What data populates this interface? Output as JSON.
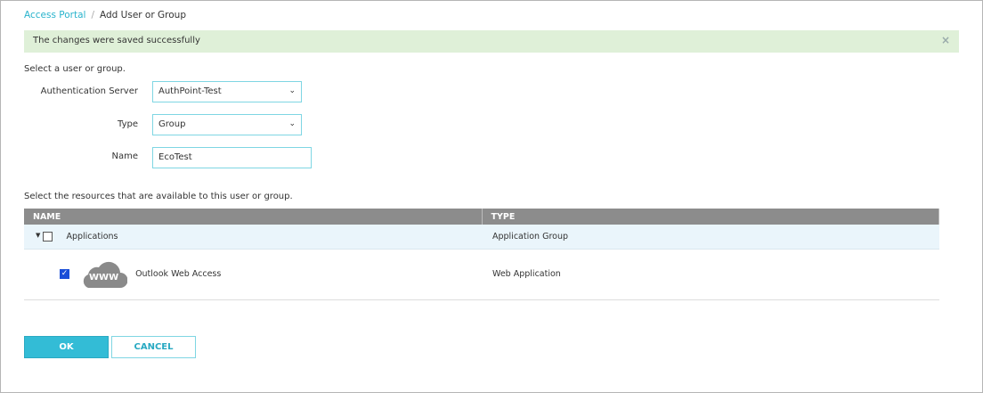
{
  "breadcrumb": {
    "parent": "Access Portal",
    "separator": "/",
    "current": "Add User or Group"
  },
  "alert": {
    "message": "The changes were saved successfully",
    "close": "×"
  },
  "form": {
    "intro": "Select a user or group.",
    "auth_server": {
      "label": "Authentication Server",
      "value": "AuthPoint-Test"
    },
    "type": {
      "label": "Type",
      "value": "Group"
    },
    "name": {
      "label": "Name",
      "value": "EcoTest"
    }
  },
  "resources": {
    "intro": "Select the resources that are available to this user or group.",
    "columns": [
      "NAME",
      "TYPE"
    ],
    "rows": [
      {
        "name": "Applications",
        "type": "Application Group",
        "checked": false
      },
      {
        "name": "Outlook Web Access",
        "type": "Web Application",
        "checked": true,
        "icon_text": "WWW"
      }
    ]
  },
  "buttons": {
    "ok": "OK",
    "cancel": "CANCEL"
  }
}
